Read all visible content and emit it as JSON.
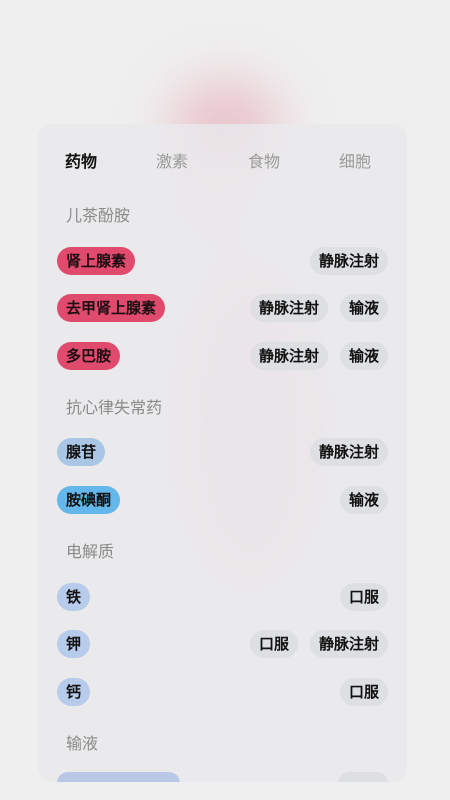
{
  "tabs": [
    {
      "label": "药物",
      "active": true
    },
    {
      "label": "激素",
      "active": false
    },
    {
      "label": "食物",
      "active": false
    },
    {
      "label": "细胞",
      "active": false
    }
  ],
  "sections": [
    {
      "title": "儿茶酚胺",
      "items": [
        {
          "name": "肾上腺素",
          "color": "#df4a6d",
          "tags": [
            "静脉注射"
          ]
        },
        {
          "name": "去甲肾上腺素",
          "color": "#df4a6d",
          "tags": [
            "静脉注射",
            "输液"
          ]
        },
        {
          "name": "多巴胺",
          "color": "#df4a6d",
          "tags": [
            "静脉注射",
            "输液"
          ]
        }
      ]
    },
    {
      "title": "抗心律失常药",
      "items": [
        {
          "name": "腺苷",
          "color": "#a9c7e5",
          "tags": [
            "静脉注射"
          ]
        },
        {
          "name": "胺碘酮",
          "color": "#63b7ea",
          "tags": [
            "输液"
          ]
        }
      ]
    },
    {
      "title": "电解质",
      "items": [
        {
          "name": "铁",
          "color": "#b7cbea",
          "tags": [
            "口服"
          ]
        },
        {
          "name": "钾",
          "color": "#b7cbea",
          "tags": [
            "口服",
            "静脉注射"
          ]
        },
        {
          "name": "钙",
          "color": "#b7cbea",
          "tags": [
            "口服"
          ]
        }
      ]
    },
    {
      "title": "输液",
      "items": []
    }
  ]
}
